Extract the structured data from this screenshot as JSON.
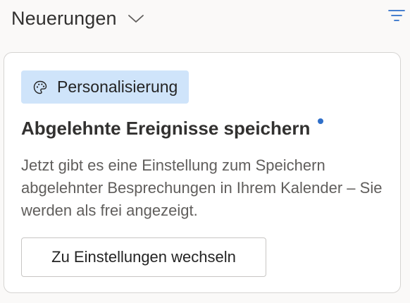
{
  "header": {
    "title": "Neuerungen",
    "dropdown_icon": "chevron-down-icon",
    "filter_icon": "filter-icon"
  },
  "card": {
    "tag": {
      "icon": "palette-icon",
      "label": "Personalisierung"
    },
    "headline": "Abgelehnte Ereignisse speichern",
    "unread_indicator_color": "#2f6fc9",
    "body": "Jetzt gibt es eine Einstellung zum Speichern abgelehnter Besprechungen in Ihrem Kalender – Sie werden als frei angezeigt.",
    "action_label": "Zu Einstellungen wechseln"
  },
  "colors": {
    "accent": "#2f6fc9",
    "tag_background": "#cfe4fa",
    "page_background": "#faf9f8"
  }
}
